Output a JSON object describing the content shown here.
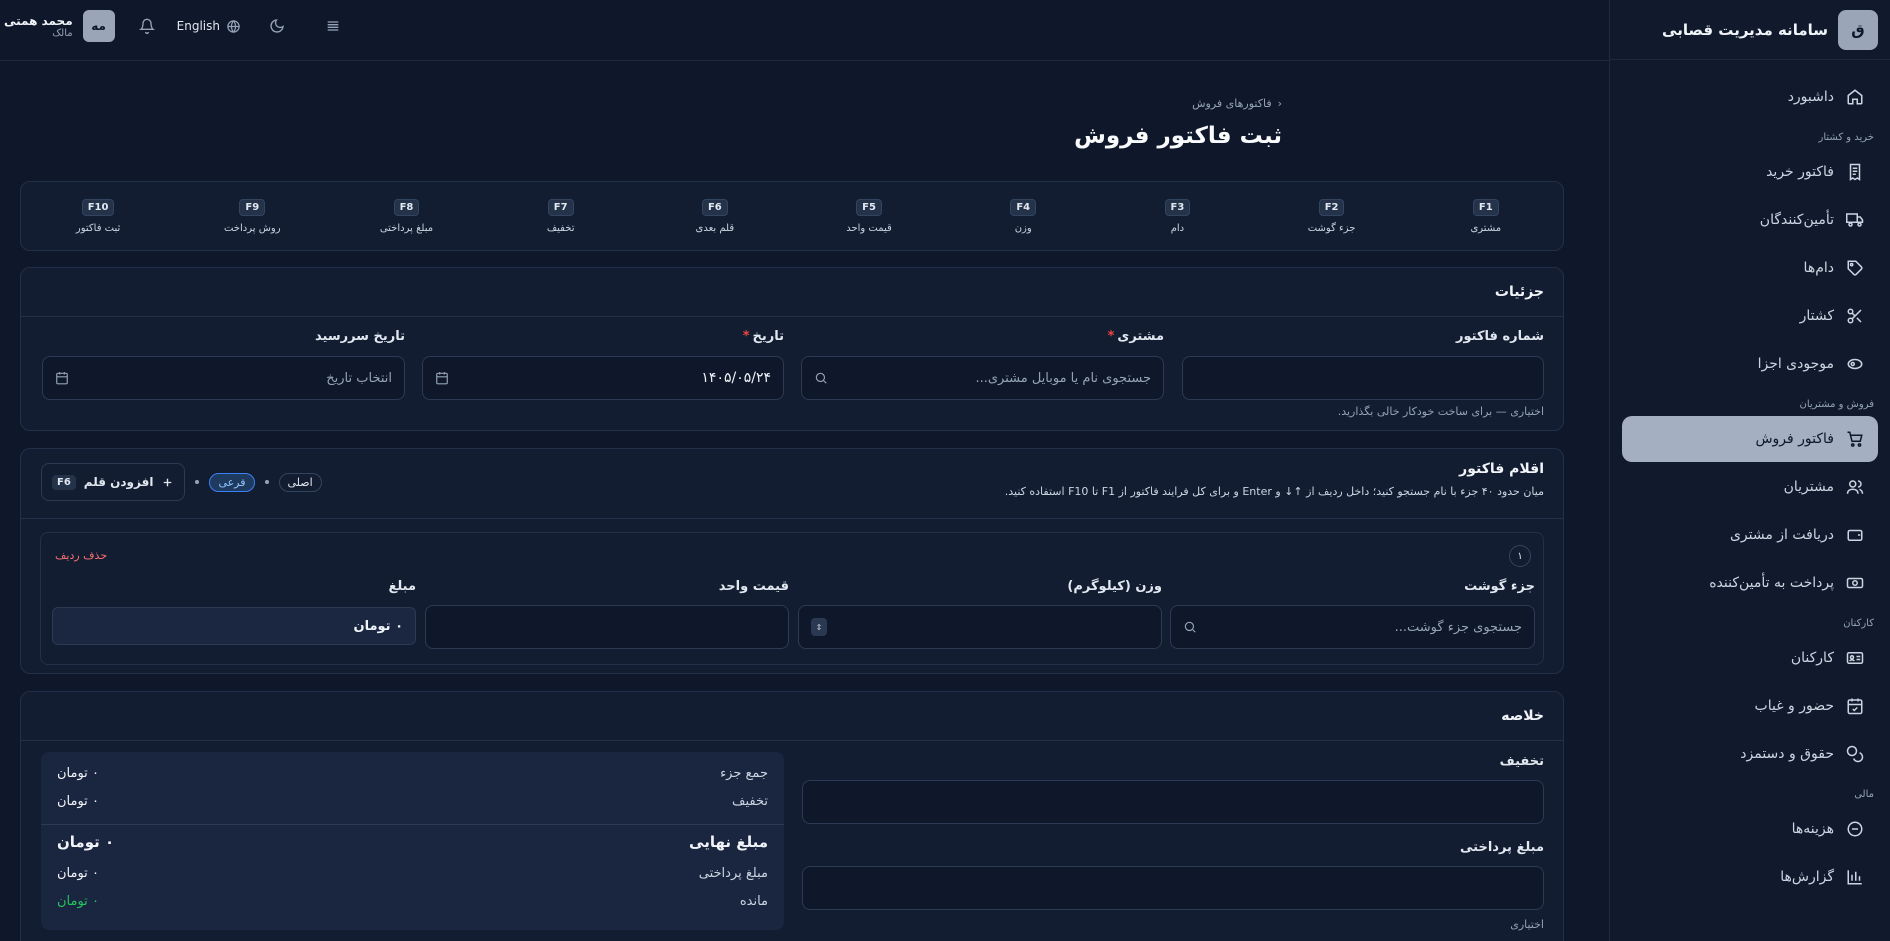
{
  "app": {
    "brand_initial": "ق",
    "brand_title": "سامانه مدیریت قصابی"
  },
  "topbar": {
    "user_name": "محمد همتی",
    "user_role": "مالک",
    "avatar_initials": "مه",
    "language": "English"
  },
  "sidebar": {
    "dashboard": "داشبورد",
    "sections": {
      "purchase": "خرید و کشتار",
      "sales": "فروش و مشتریان",
      "staff": "کارکنان",
      "finance": "مالی"
    },
    "items": {
      "purchase_invoice": "فاکتور خرید",
      "suppliers": "تأمین‌کنندگان",
      "livestock": "دام‌ها",
      "slaughter": "کشتار",
      "parts_stock": "موجودی اجزا",
      "sales_invoice": "فاکتور فروش",
      "customers": "مشتریان",
      "receive_customer": "دریافت از مشتری",
      "pay_supplier": "پرداخت به تأمین‌کننده",
      "employees": "کارکنان",
      "attendance": "حضور و غیاب",
      "payroll": "حقوق و دستمزد",
      "expenses": "هزینه‌ها",
      "reports": "گزارش‌ها"
    }
  },
  "page": {
    "breadcrumb": "فاکتورهای فروش",
    "title": "ثبت فاکتور فروش"
  },
  "shortcuts": [
    {
      "key": "F10",
      "label": "ثبت فاکتور"
    },
    {
      "key": "F9",
      "label": "روش پرداخت"
    },
    {
      "key": "F8",
      "label": "مبلغ پرداختی"
    },
    {
      "key": "F7",
      "label": "تخفیف"
    },
    {
      "key": "F6",
      "label": "قلم بعدی"
    },
    {
      "key": "F5",
      "label": "قیمت واحد"
    },
    {
      "key": "F4",
      "label": "وزن"
    },
    {
      "key": "F3",
      "label": "دام"
    },
    {
      "key": "F2",
      "label": "جزء گوشت"
    },
    {
      "key": "F1",
      "label": "مشتری"
    }
  ],
  "details": {
    "title": "جزئیات",
    "invoice_number_label": "شماره فاکتور",
    "invoice_number_value": "",
    "invoice_hint": "اختیاری — برای ساخت خودکار خالی بگذارید.",
    "customer_label": "مشتری",
    "customer_placeholder": "جستجوی نام یا موبایل مشتری...",
    "date_label": "تاریخ",
    "date_value": "۱۴۰۵/۰۵/۲۴",
    "due_date_label": "تاریخ سررسید",
    "due_date_placeholder": "انتخاب تاریخ"
  },
  "items": {
    "title": "اقلام فاکتور",
    "description": "میان حدود ۴۰ جزء با نام جستجو کنید؛ داخل ردیف از ↑↓ و Enter و برای کل فرایند فاکتور از F1 تا F10 استفاده کنید.",
    "add_button": "افزودن قلم",
    "add_key": "F6",
    "tag_main": "اصلی",
    "tag_sub": "فرعی",
    "row": {
      "number": "۱",
      "delete": "حذف ردیف",
      "part_label": "جزء گوشت",
      "part_placeholder": "جستجوی جزء گوشت...",
      "weight_label": "وزن (کیلوگرم)",
      "unit_price_label": "قیمت واحد",
      "amount_label": "مبلغ",
      "amount_value": "۰ تومان"
    }
  },
  "summary": {
    "title": "خلاصه",
    "discount_label": "تخفیف",
    "payment_label": "مبلغ پرداختی",
    "payment_hint": "اختیاری",
    "rows": {
      "subtotal_label": "جمع جزء",
      "subtotal_value": "۰ تومان",
      "discount_label": "تخفیف",
      "discount_value": "۰ تومان",
      "final_label": "مبلغ نهایی",
      "final_value": "۰ تومان",
      "paid_label": "مبلغ پرداختی",
      "paid_value": "۰ تومان",
      "remaining_label": "مانده",
      "remaining_value": "۰ تومان"
    }
  },
  "colors": {
    "accent": "#a4b0c1",
    "danger": "#ef4444",
    "success": "#22c55e"
  }
}
